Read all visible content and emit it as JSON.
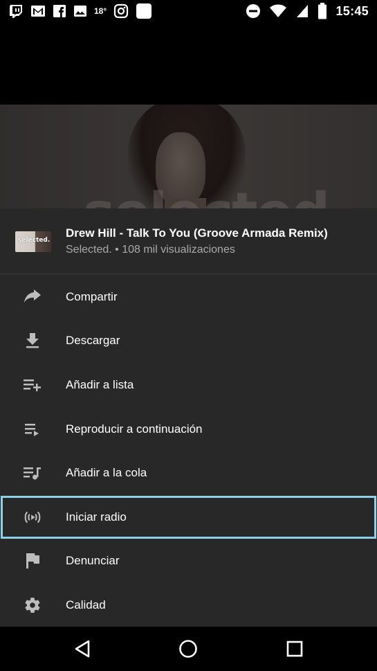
{
  "status_bar": {
    "left_icons": [
      "twitch-icon",
      "gmail-icon",
      "facebook-icon",
      "gallery-icon",
      "instagram-icon",
      "app-square-icon"
    ],
    "temperature": "18°",
    "right_icons": [
      "do-not-disturb-icon",
      "wifi-icon",
      "sim-no-signal-icon",
      "battery-icon"
    ],
    "time": "15:45"
  },
  "video": {
    "thumbnail_watermark": "selected"
  },
  "sheet": {
    "thumbnail_text": "selected.",
    "title": "Drew Hill - Talk To You (Groove Armada Remix)",
    "subtitle": "Selected. • 108 mil visualizaciones",
    "items": [
      {
        "label": "Compartir",
        "icon": "share-icon"
      },
      {
        "label": "Descargar",
        "icon": "download-icon"
      },
      {
        "label": "Añadir a lista",
        "icon": "playlist-add-icon"
      },
      {
        "label": "Reproducir a continuación",
        "icon": "play-next-icon"
      },
      {
        "label": "Añadir a la cola",
        "icon": "queue-music-icon"
      },
      {
        "label": "Iniciar radio",
        "icon": "radio-icon"
      },
      {
        "label": "Denunciar",
        "icon": "flag-icon"
      },
      {
        "label": "Calidad",
        "icon": "gear-icon"
      }
    ],
    "focused_item": "Iniciar radio"
  },
  "nav_bar": {
    "buttons": [
      "back-icon",
      "home-icon",
      "recents-icon"
    ]
  },
  "colors": {
    "sheet_background": "#282828",
    "focus_outline": "#8cd1e9",
    "secondary_text": "#aaaaaa",
    "icon_color": "#bdbdbd"
  }
}
